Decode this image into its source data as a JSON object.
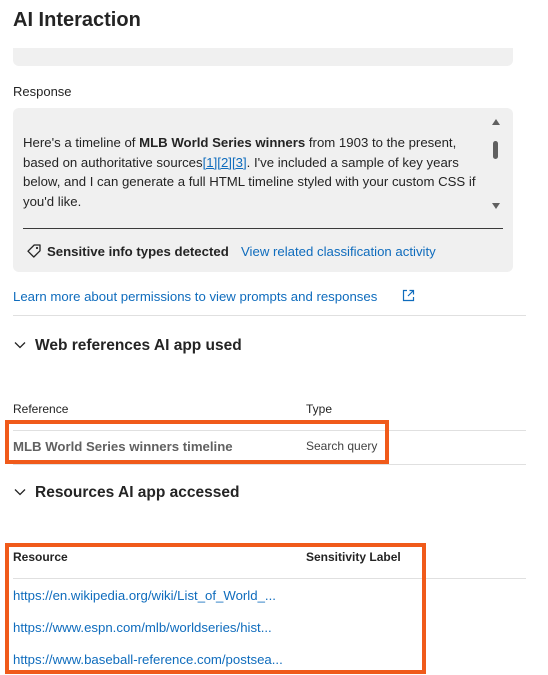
{
  "header": {
    "title": "AI Interaction"
  },
  "response": {
    "label": "Response",
    "text_before_bold": "Here's a timeline of ",
    "text_bold": "MLB World Series winners",
    "text_after_bold": " from 1903 to the present, based on authoritative sources",
    "citations": [
      "[1]",
      "[2]",
      "[3]"
    ],
    "text_end": ". I've included a sample of key years below, and I can generate a full HTML timeline styled with your custom CSS if you'd like.",
    "sensitive_label": "Sensitive info types detected",
    "classification_link": "View related classification activity"
  },
  "learn_more_link": "Learn more about permissions to view prompts and responses",
  "web_references": {
    "heading": "Web references AI app used",
    "col_reference": "Reference",
    "col_type": "Type",
    "rows": [
      {
        "reference": "MLB World Series winners timeline",
        "type": "Search query"
      }
    ]
  },
  "resources": {
    "heading": "Resources AI app accessed",
    "col_resource": "Resource",
    "col_sensitivity": "Sensitivity Label",
    "rows": [
      {
        "url": "https://en.wikipedia.org/wiki/List_of_World_..."
      },
      {
        "url": "https://www.espn.com/mlb/worldseries/hist..."
      },
      {
        "url": "https://www.baseball-reference.com/postsea..."
      }
    ]
  },
  "colors": {
    "link": "#0f6cbd",
    "highlight": "#f05a1a",
    "card_bg": "#f0f0f0"
  },
  "icons": [
    "tag-icon",
    "external-link-icon",
    "chevron-down-icon",
    "scroll-up-arrow",
    "scroll-down-arrow"
  ]
}
